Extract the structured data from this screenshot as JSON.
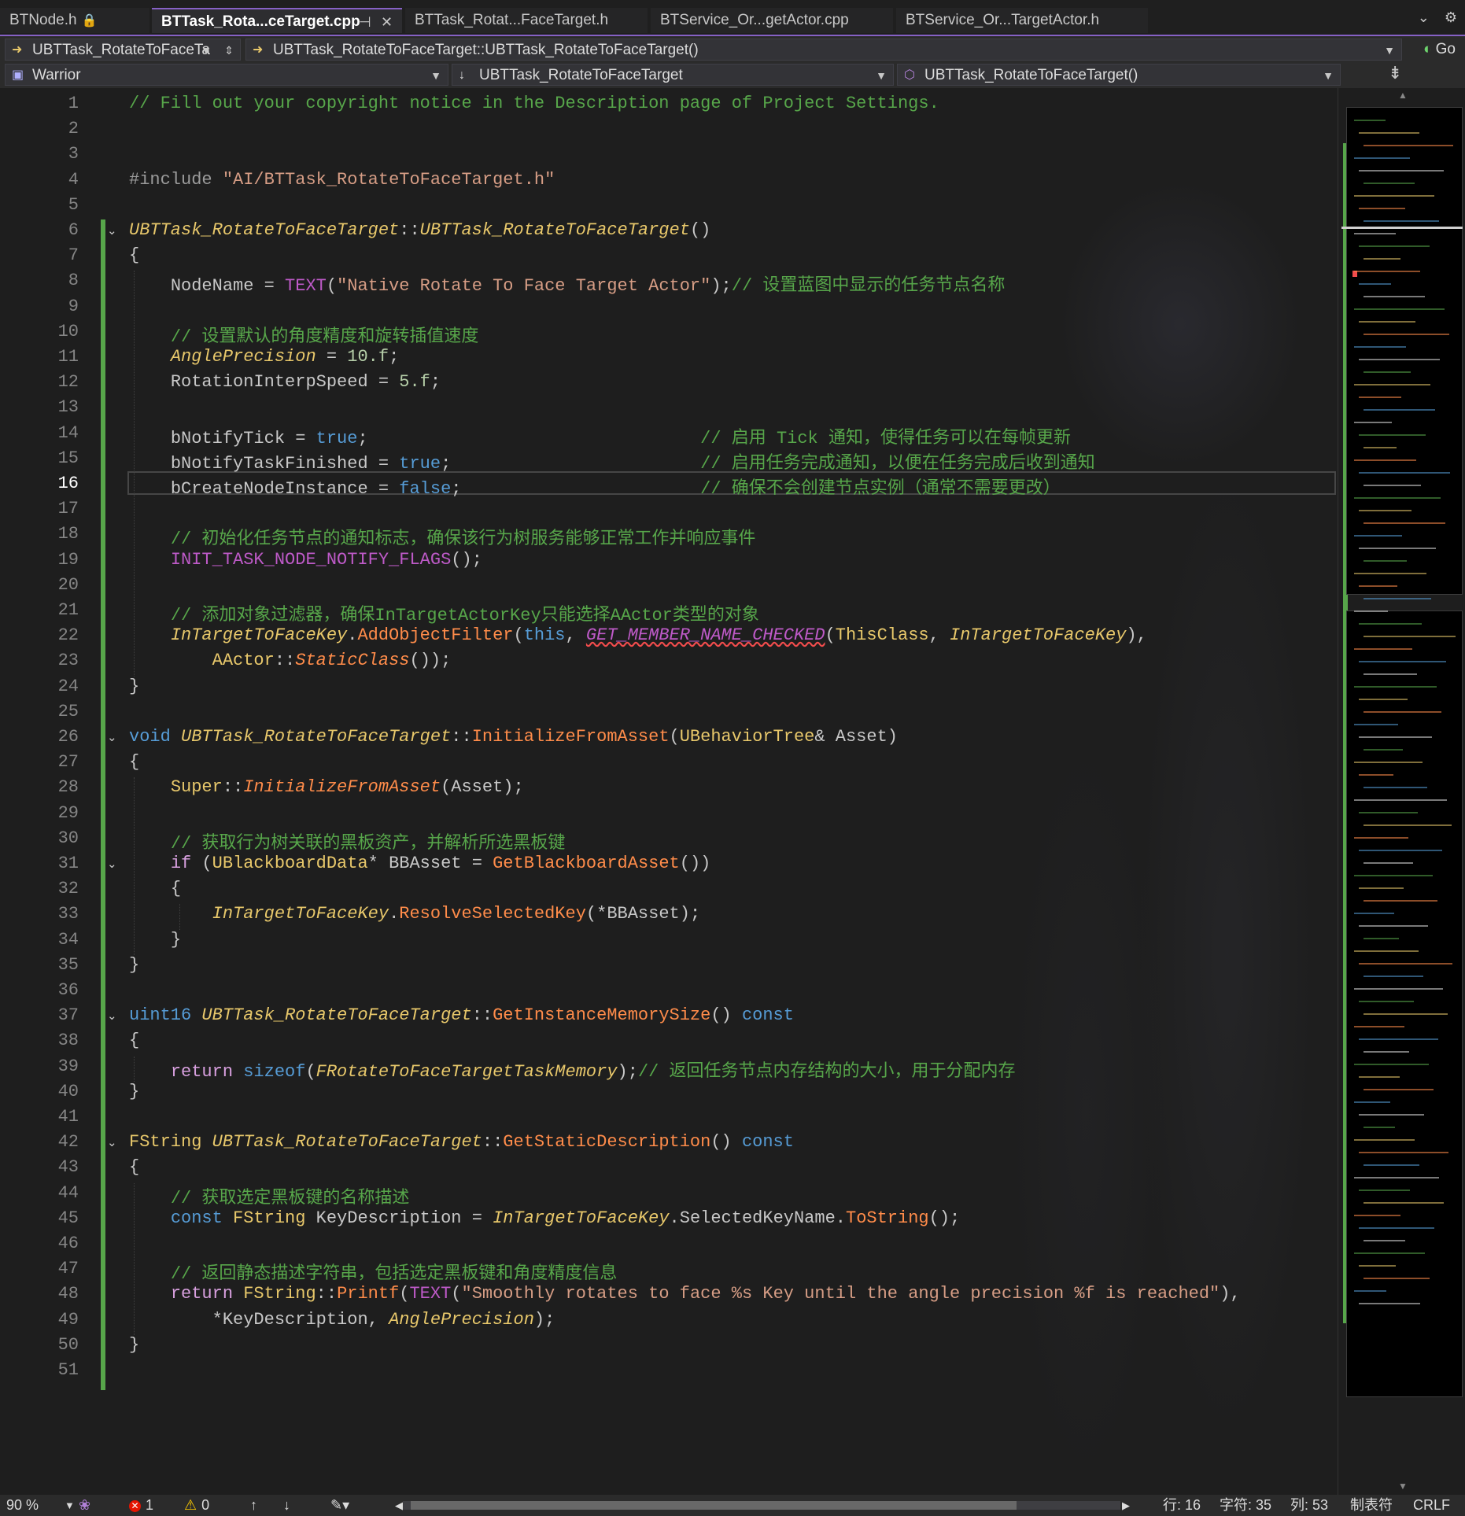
{
  "tabs": [
    {
      "label": "BTNode.h",
      "lock": "🔒",
      "active": false
    },
    {
      "label": "BTTask_Rota...ceTarget.cpp",
      "pin": "⊣",
      "close": "✕",
      "active": true
    },
    {
      "label": "BTTask_Rotat...FaceTarget.h",
      "active": false
    },
    {
      "label": "BTService_Or...getActor.cpp",
      "active": false
    },
    {
      "label": "BTService_Or...TargetActor.h",
      "active": false
    }
  ],
  "tabbar_right": {
    "overflow": "⌄",
    "settings": "⚙"
  },
  "nav1": {
    "scope": "UBTTask_RotateToFaceTa",
    "member": "UBTTask_RotateToFaceTarget::UBTTask_RotateToFaceTarget()",
    "go": "Go"
  },
  "nav2": {
    "project": "Warrior",
    "class": "UBTTask_RotateToFaceTarget",
    "function": "UBTTask_RotateToFaceTarget()"
  },
  "editor": {
    "line_count": 51,
    "current_line": 16,
    "lines": [
      "// Fill out your copyright notice in the Description page of Project Settings.",
      "",
      "",
      "#include \"AI/BTTask_RotateToFaceTarget.h\"",
      "",
      "UBTTask_RotateToFaceTarget::UBTTask_RotateToFaceTarget()",
      "{",
      "    NodeName = TEXT(\"Native Rotate To Face Target Actor\");// 设置蓝图中显示的任务节点名称",
      "",
      "    // 设置默认的角度精度和旋转插值速度",
      "    AnglePrecision = 10.f;",
      "    RotationInterpSpeed = 5.f;",
      "",
      "    bNotifyTick = true;                                // 启用 Tick 通知，使得任务可以在每帧更新",
      "    bNotifyTaskFinished = true;                        // 启用任务完成通知，以便在任务完成后收到通知",
      "    bCreateNodeInstance = false;                       // 确保不会创建节点实例（通常不需要更改）",
      "",
      "    // 初始化任务节点的通知标志，确保该行为树服务能够正常工作并响应事件",
      "    INIT_TASK_NODE_NOTIFY_FLAGS();",
      "",
      "    // 添加对象过滤器，确保InTargetActorKey只能选择AActor类型的对象",
      "    InTargetToFaceKey.AddObjectFilter(this, GET_MEMBER_NAME_CHECKED(ThisClass, InTargetToFaceKey),",
      "        AActor::StaticClass());",
      "}",
      "",
      "void UBTTask_RotateToFaceTarget::InitializeFromAsset(UBehaviorTree& Asset)",
      "{",
      "    Super::InitializeFromAsset(Asset);",
      "",
      "    // 获取行为树关联的黑板资产，并解析所选黑板键",
      "    if (UBlackboardData* BBAsset = GetBlackboardAsset())",
      "    {",
      "        InTargetToFaceKey.ResolveSelectedKey(*BBAsset);",
      "    }",
      "}",
      "",
      "uint16 UBTTask_RotateToFaceTarget::GetInstanceMemorySize() const",
      "{",
      "    return sizeof(FRotateToFaceTargetTaskMemory);// 返回任务节点内存结构的大小，用于分配内存",
      "}",
      "",
      "FString UBTTask_RotateToFaceTarget::GetStaticDescription() const",
      "{",
      "    // 获取选定黑板键的名称描述",
      "    const FString KeyDescription = InTargetToFaceKey.SelectedKeyName.ToString();",
      "",
      "    // 返回静态描述字符串，包括选定黑板键和角度精度信息",
      "    return FString::Printf(TEXT(\"Smoothly rotates to face %s Key until the angle precision %f is reached\"),",
      "        *KeyDescription, AnglePrecision);",
      "}",
      ""
    ]
  },
  "status": {
    "zoom": "90 %",
    "errors": "1",
    "warnings": "0",
    "line": "行: 16",
    "char": "字符: 35",
    "col": "列: 53",
    "indent": "制表符",
    "eol": "CRLF"
  },
  "colors": {
    "accent": "#8661c5",
    "comment": "#57a64a",
    "keyword": "#569cd6",
    "function": "#ff8c4a",
    "macro": "#be5ac8",
    "string": "#d69d85",
    "class": "#e8c86b"
  }
}
